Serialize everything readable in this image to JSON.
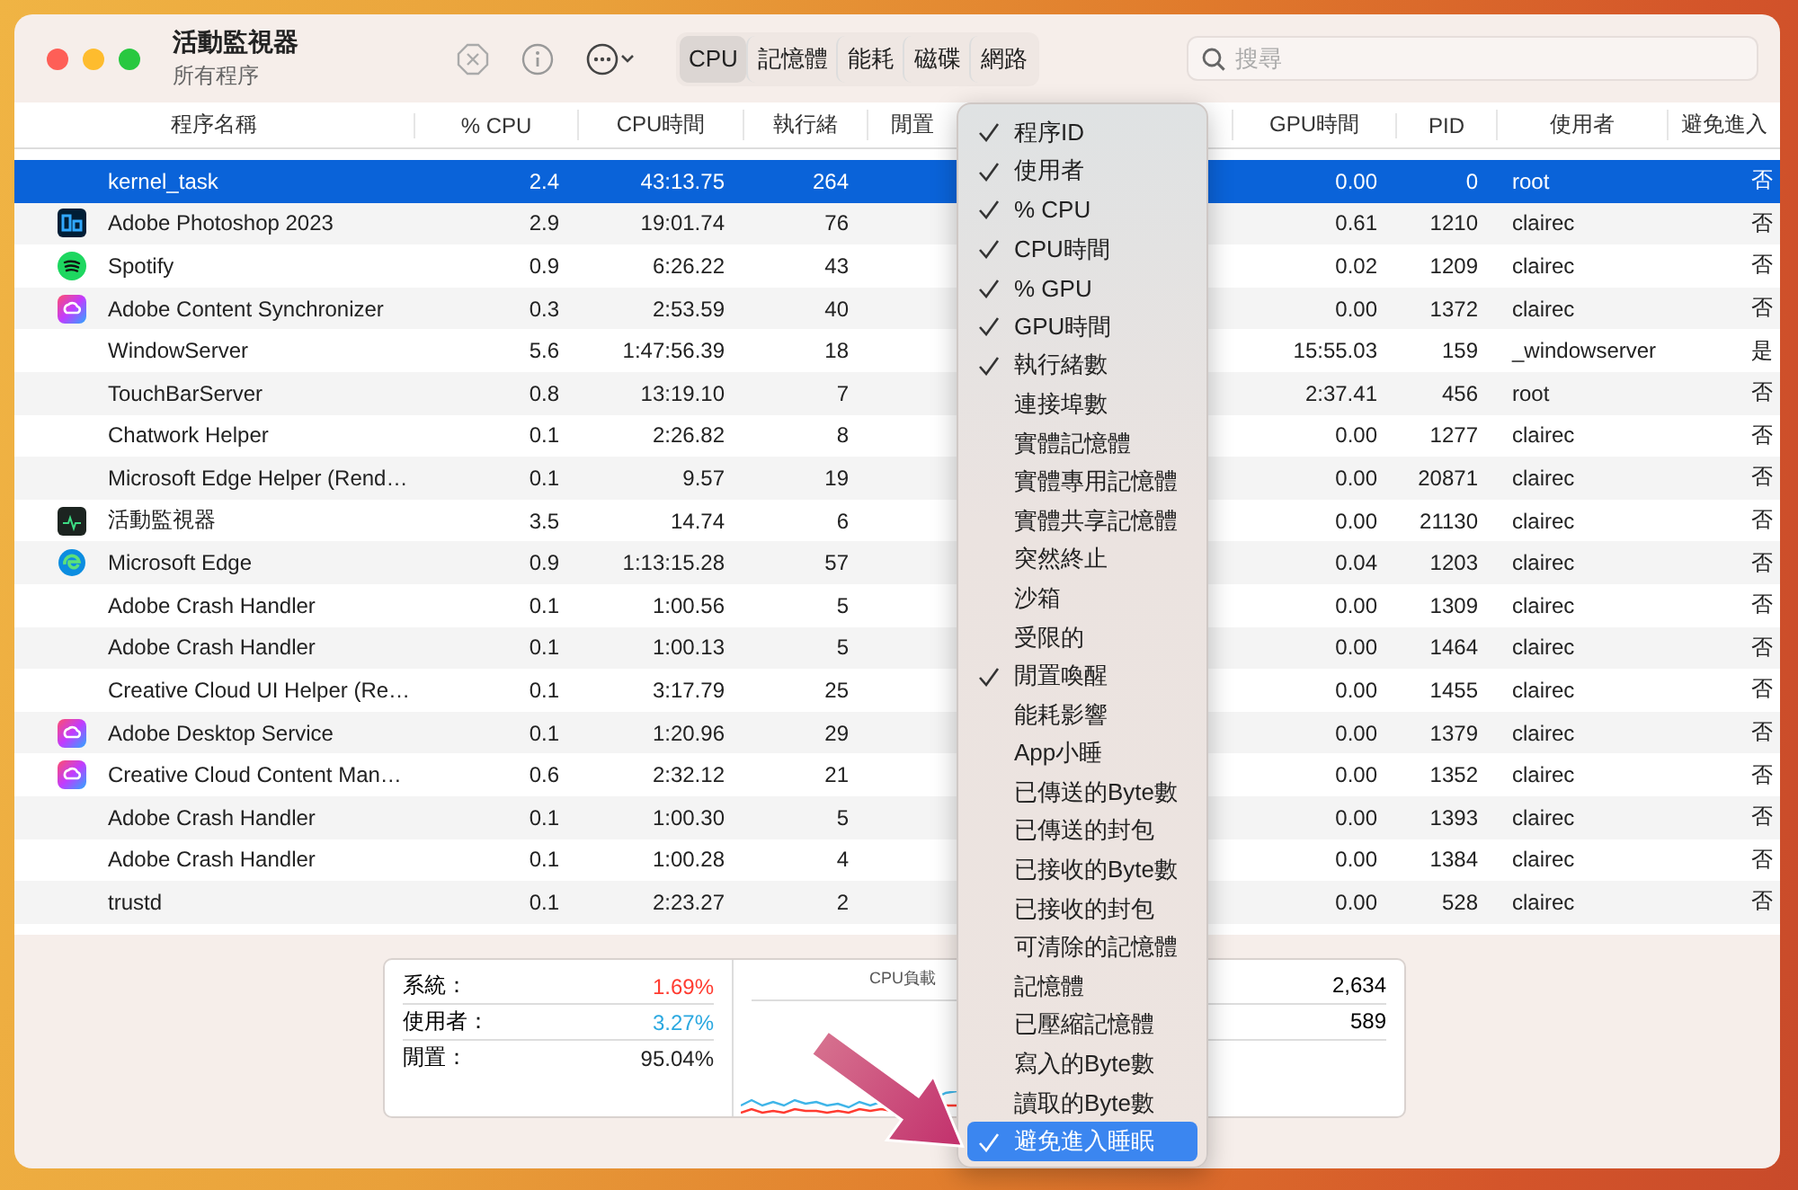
{
  "window": {
    "title": "活動監視器",
    "subtitle": "所有程序"
  },
  "toolbar": {
    "tabs": [
      {
        "label": "CPU",
        "selected": true
      },
      {
        "label": "記憶體",
        "selected": false
      },
      {
        "label": "能耗",
        "selected": false
      },
      {
        "label": "磁碟",
        "selected": false
      },
      {
        "label": "網路",
        "selected": false
      }
    ],
    "search": {
      "placeholder": "搜尋"
    }
  },
  "table": {
    "columns": [
      "程序名稱",
      "% CPU",
      "CPU時間",
      "執行緒",
      "閒置",
      "GPU時間",
      "PID",
      "使用者",
      "避免進入"
    ],
    "rows": [
      {
        "name": "kernel_task",
        "cpu": "2.4",
        "cpu_time": "43:13.75",
        "threads": "264",
        "gpu_time": "0.00",
        "pid": "0",
        "user": "root",
        "prevent_sleep": "否",
        "selected": true
      },
      {
        "kind": "photoshop",
        "name": "Adobe Photoshop 2023",
        "cpu": "2.9",
        "cpu_time": "19:01.74",
        "threads": "76",
        "gpu_time": "0.61",
        "pid": "1210",
        "user": "clairec",
        "prevent_sleep": "否",
        "selected": false
      },
      {
        "kind": "spotify",
        "name": "Spotify",
        "cpu": "0.9",
        "cpu_time": "6:26.22",
        "threads": "43",
        "gpu_time": "0.02",
        "pid": "1209",
        "user": "clairec",
        "prevent_sleep": "否",
        "selected": false
      },
      {
        "kind": "creative-cloud",
        "name": "Adobe Content Synchronizer",
        "cpu": "0.3",
        "cpu_time": "2:53.59",
        "threads": "40",
        "gpu_time": "0.00",
        "pid": "1372",
        "user": "clairec",
        "prevent_sleep": "否",
        "selected": false
      },
      {
        "name": "WindowServer",
        "cpu": "5.6",
        "cpu_time": "1:47:56.39",
        "threads": "18",
        "gpu_time": "15:55.03",
        "pid": "159",
        "user": "_windowserver",
        "prevent_sleep": "是",
        "selected": false
      },
      {
        "name": "TouchBarServer",
        "cpu": "0.8",
        "cpu_time": "13:19.10",
        "threads": "7",
        "gpu_time": "2:37.41",
        "pid": "456",
        "user": "root",
        "prevent_sleep": "否",
        "selected": false
      },
      {
        "name": "Chatwork Helper",
        "cpu": "0.1",
        "cpu_time": "2:26.82",
        "threads": "8",
        "gpu_time": "0.00",
        "pid": "1277",
        "user": "clairec",
        "prevent_sleep": "否",
        "selected": false
      },
      {
        "name": "Microsoft Edge Helper (Rend…",
        "cpu": "0.1",
        "cpu_time": "9.57",
        "threads": "19",
        "gpu_time": "0.00",
        "pid": "20871",
        "user": "clairec",
        "prevent_sleep": "否",
        "selected": false
      },
      {
        "kind": "activity-monitor",
        "name": "活動監視器",
        "cpu": "3.5",
        "cpu_time": "14.74",
        "threads": "6",
        "gpu_time": "0.00",
        "pid": "21130",
        "user": "clairec",
        "prevent_sleep": "否",
        "selected": false
      },
      {
        "kind": "edge",
        "name": "Microsoft Edge",
        "cpu": "0.9",
        "cpu_time": "1:13:15.28",
        "threads": "57",
        "gpu_time": "0.04",
        "pid": "1203",
        "user": "clairec",
        "prevent_sleep": "否",
        "selected": false
      },
      {
        "name": "Adobe Crash Handler",
        "cpu": "0.1",
        "cpu_time": "1:00.56",
        "threads": "5",
        "gpu_time": "0.00",
        "pid": "1309",
        "user": "clairec",
        "prevent_sleep": "否",
        "selected": false
      },
      {
        "name": "Adobe Crash Handler",
        "cpu": "0.1",
        "cpu_time": "1:00.13",
        "threads": "5",
        "gpu_time": "0.00",
        "pid": "1464",
        "user": "clairec",
        "prevent_sleep": "否",
        "selected": false
      },
      {
        "name": "Creative Cloud UI Helper (Re…",
        "cpu": "0.1",
        "cpu_time": "3:17.79",
        "threads": "25",
        "gpu_time": "0.00",
        "pid": "1455",
        "user": "clairec",
        "prevent_sleep": "否",
        "selected": false
      },
      {
        "kind": "creative-cloud",
        "name": "Adobe Desktop Service",
        "cpu": "0.1",
        "cpu_time": "1:20.96",
        "threads": "29",
        "gpu_time": "0.00",
        "pid": "1379",
        "user": "clairec",
        "prevent_sleep": "否",
        "selected": false
      },
      {
        "kind": "creative-cloud",
        "name": "Creative Cloud Content Man…",
        "cpu": "0.6",
        "cpu_time": "2:32.12",
        "threads": "21",
        "gpu_time": "0.00",
        "pid": "1352",
        "user": "clairec",
        "prevent_sleep": "否",
        "selected": false
      },
      {
        "name": "Adobe Crash Handler",
        "cpu": "0.1",
        "cpu_time": "1:00.30",
        "threads": "5",
        "gpu_time": "0.00",
        "pid": "1393",
        "user": "clairec",
        "prevent_sleep": "否",
        "selected": false
      },
      {
        "name": "Adobe Crash Handler",
        "cpu": "0.1",
        "cpu_time": "1:00.28",
        "threads": "4",
        "gpu_time": "0.00",
        "pid": "1384",
        "user": "clairec",
        "prevent_sleep": "否",
        "selected": false
      },
      {
        "name": "trustd",
        "cpu": "0.1",
        "cpu_time": "2:23.27",
        "threads": "2",
        "gpu_time": "0.00",
        "pid": "528",
        "user": "clairec",
        "prevent_sleep": "否",
        "selected": false
      }
    ]
  },
  "column_menu": {
    "items": [
      {
        "label": "程序ID",
        "checked": true,
        "selected": false
      },
      {
        "label": "使用者",
        "checked": true,
        "selected": false
      },
      {
        "label": "% CPU",
        "checked": true,
        "selected": false
      },
      {
        "label": "CPU時間",
        "checked": true,
        "selected": false
      },
      {
        "label": "% GPU",
        "checked": true,
        "selected": false
      },
      {
        "label": "GPU時間",
        "checked": true,
        "selected": false
      },
      {
        "label": "執行緒數",
        "checked": true,
        "selected": false
      },
      {
        "label": "連接埠數",
        "checked": false,
        "selected": false
      },
      {
        "label": "實體記憶體",
        "checked": false,
        "selected": false
      },
      {
        "label": "實體專用記憶體",
        "checked": false,
        "selected": false
      },
      {
        "label": "實體共享記憶體",
        "checked": false,
        "selected": false
      },
      {
        "label": "突然終止",
        "checked": false,
        "selected": false
      },
      {
        "label": "沙箱",
        "checked": false,
        "selected": false
      },
      {
        "label": "受限的",
        "checked": false,
        "selected": false
      },
      {
        "label": "閒置喚醒",
        "checked": true,
        "selected": false
      },
      {
        "label": "能耗影響",
        "checked": false,
        "selected": false
      },
      {
        "label": "App小睡",
        "checked": false,
        "selected": false
      },
      {
        "label": "已傳送的Byte數",
        "checked": false,
        "selected": false
      },
      {
        "label": "已傳送的封包",
        "checked": false,
        "selected": false
      },
      {
        "label": "已接收的Byte數",
        "checked": false,
        "selected": false
      },
      {
        "label": "已接收的封包",
        "checked": false,
        "selected": false
      },
      {
        "label": "可清除的記憶體",
        "checked": false,
        "selected": false
      },
      {
        "label": "記憶體",
        "checked": false,
        "selected": false
      },
      {
        "label": "已壓縮記憶體",
        "checked": false,
        "selected": false
      },
      {
        "label": "寫入的Byte數",
        "checked": false,
        "selected": false
      },
      {
        "label": "讀取的Byte數",
        "checked": false,
        "selected": false
      },
      {
        "label": "避免進入睡眠",
        "checked": true,
        "selected": true
      }
    ]
  },
  "summary": {
    "stats": [
      {
        "kind": "system",
        "label": "系統：",
        "value": "1.69%"
      },
      {
        "kind": "user",
        "label": "使用者：",
        "value": "3.27%"
      },
      {
        "kind": "idle",
        "label": "閒置：",
        "value": "95.04%"
      }
    ],
    "chart_title": "CPU負載",
    "counts": [
      "2,634",
      "589"
    ]
  }
}
